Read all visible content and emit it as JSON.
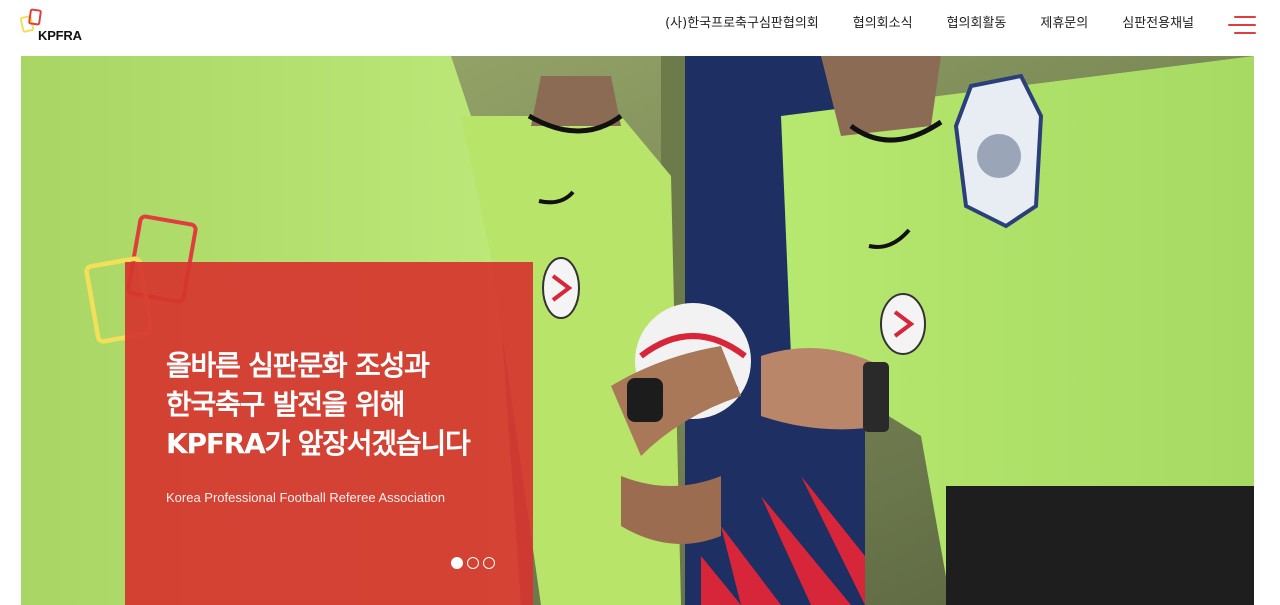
{
  "brand": {
    "logo_text": "KPFRA"
  },
  "nav": {
    "items": [
      {
        "label": "(사)한국프로축구심판협의회"
      },
      {
        "label": "협의회소식"
      },
      {
        "label": "협의회활동"
      },
      {
        "label": "제휴문의"
      },
      {
        "label": "심판전용채널"
      }
    ]
  },
  "hero": {
    "title_lines": [
      "올바른 심판문화 조성과",
      "한국축구 발전을 위해",
      "KPFRA가 앞장서겠습니다"
    ],
    "subtitle": "Korea Professional Football Referee Association",
    "slides_total": 3,
    "slide_active": 1
  },
  "colors": {
    "accent": "#e03e3e",
    "card": "#d6342f",
    "card_yellow": "#f3e05a",
    "referee_shirt": "#b6e86a"
  },
  "icons": {
    "menu": "hamburger-menu-icon",
    "red_card": "red-card-icon",
    "yellow_card": "yellow-card-icon"
  }
}
